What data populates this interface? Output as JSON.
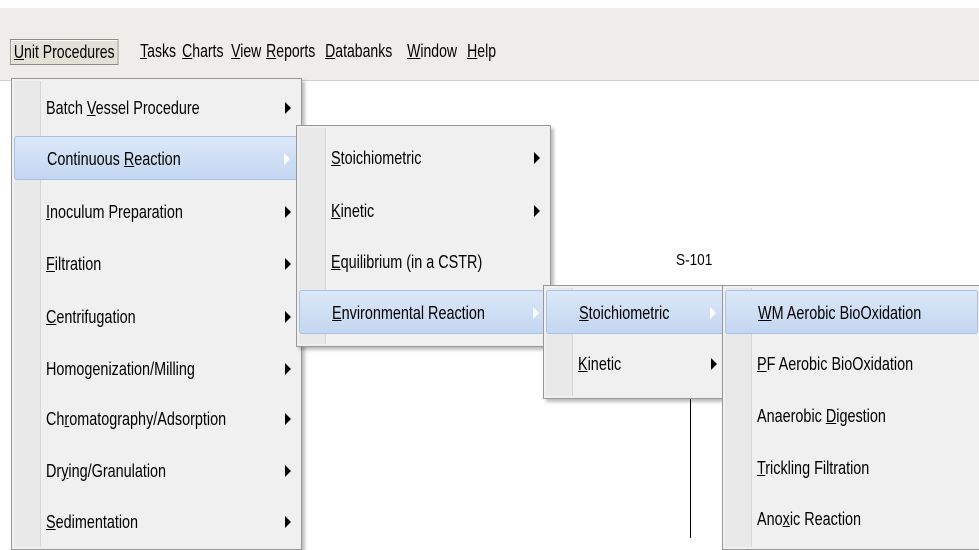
{
  "menubar": {
    "items": [
      {
        "pre": "",
        "u": "U",
        "post": "nit Procedures"
      },
      {
        "pre": "",
        "u": "T",
        "post": "asks"
      },
      {
        "pre": "",
        "u": "C",
        "post": "harts"
      },
      {
        "pre": "",
        "u": "V",
        "post": "iew"
      },
      {
        "pre": "",
        "u": "R",
        "post": "eports"
      },
      {
        "pre": "",
        "u": "D",
        "post": "atabanks"
      },
      {
        "pre": "",
        "u": "W",
        "post": "indow"
      },
      {
        "pre": "",
        "u": "H",
        "post": "elp"
      }
    ]
  },
  "unit_procedures_menu": {
    "items": [
      {
        "pre": "Batch ",
        "u": "V",
        "post": "essel Procedure"
      },
      {
        "pre": "Continuous ",
        "u": "R",
        "post": "eaction"
      },
      {
        "pre": "",
        "u": "I",
        "post": "noculum Preparation"
      },
      {
        "pre": "",
        "u": "F",
        "post": "iltration"
      },
      {
        "pre": "",
        "u": "C",
        "post": "entrifugation"
      },
      {
        "pre": "Homo",
        "u": "g",
        "post": "enization/Milling"
      },
      {
        "pre": "Ch",
        "u": "r",
        "post": "omatography/Adsorption"
      },
      {
        "pre": "Dr",
        "u": "y",
        "post": "ing/Granulation"
      },
      {
        "pre": "",
        "u": "S",
        "post": "edimentation"
      }
    ]
  },
  "continuous_reaction_menu": {
    "items": [
      {
        "pre": "",
        "u": "S",
        "post": "toichiometric"
      },
      {
        "pre": "",
        "u": "K",
        "post": "inetic"
      },
      {
        "pre": "",
        "u": "E",
        "post": "quilibrium (in a CSTR)"
      },
      {
        "pre": "",
        "u": "E",
        "post": "nvironmental Reaction"
      }
    ]
  },
  "environmental_reaction_menu": {
    "items": [
      {
        "pre": "",
        "u": "S",
        "post": "toichiometric"
      },
      {
        "pre": "",
        "u": "K",
        "post": "inetic"
      }
    ]
  },
  "stoichiometric_menu": {
    "items": [
      {
        "pre": "",
        "u": "W",
        "post": "M Aerobic BioOxidation"
      },
      {
        "pre": "",
        "u": "P",
        "post": "F Aerobic BioOxidation"
      },
      {
        "pre": "Anaerobic ",
        "u": "D",
        "post": "igestion"
      },
      {
        "pre": "",
        "u": "T",
        "post": "rickling Filtration"
      },
      {
        "pre": "Ano",
        "u": "x",
        "post": "ic Reaction"
      }
    ]
  },
  "canvas": {
    "stream_label": "S-101"
  }
}
